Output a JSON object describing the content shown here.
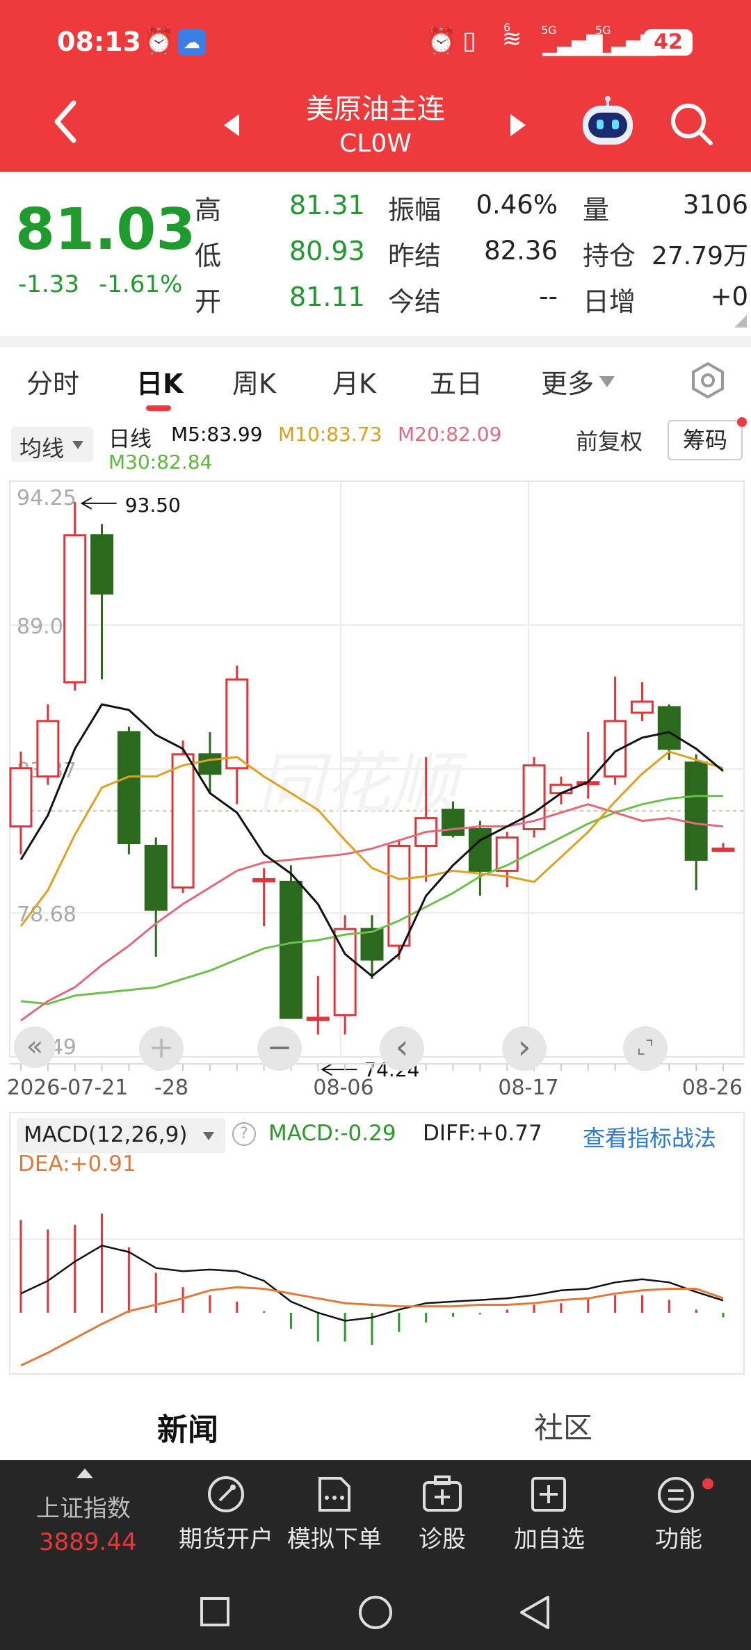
{
  "status_bar": {
    "time": "08:13",
    "signal1": "5G",
    "signal2": "5G",
    "battery": "42",
    "wifi_badge": "6"
  },
  "header": {
    "title": "美原油主连",
    "code": "CL0W"
  },
  "quote": {
    "price": "81.03",
    "change": "-1.33",
    "change_pct": "-1.61%",
    "fields": [
      {
        "label": "高",
        "value": "81.31"
      },
      {
        "label": "低",
        "value": "80.93"
      },
      {
        "label": "开",
        "value": "81.11"
      },
      {
        "label": "振幅",
        "value": "0.46%"
      },
      {
        "label": "昨结",
        "value": "82.36"
      },
      {
        "label": "今结",
        "value": "--"
      },
      {
        "label": "量",
        "value": "3106"
      },
      {
        "label": "持仓",
        "value": "27.79万"
      },
      {
        "label": "日增",
        "value": "+0"
      }
    ]
  },
  "tabs": [
    "分时",
    "日K",
    "周K",
    "月K",
    "五日",
    "更多"
  ],
  "active_tab": "日K",
  "ma_bar": {
    "selector": "均线",
    "kind": "日线",
    "m5": "M5:83.99",
    "m10": "M10:83.73",
    "m20": "M20:82.09",
    "m30": "M30:82.84",
    "fq": "前复权",
    "chip": "筹码"
  },
  "colors": {
    "red": "#ee3a3c",
    "up": "#e3343b",
    "down": "#2b6a1c",
    "m5": "#111111",
    "m10": "#e0a020",
    "m20": "#e06a7a",
    "m30": "#6cc04a",
    "dea": "#e07a3a",
    "accent_blue": "#2a7bd6"
  },
  "chart_data": {
    "type": "candlestick",
    "y_ticks": [
      "94.25",
      "89.06",
      "83.87",
      "78.68",
      "73.49"
    ],
    "ylim": [
      73.49,
      94.25
    ],
    "x_ticks": [
      "2026-07-21",
      "-28",
      "08-06",
      "08-17",
      "08-26"
    ],
    "annotations": {
      "high": "93.50",
      "low": "74.24"
    },
    "candles": [
      {
        "o": 81.8,
        "h": 84.5,
        "l": 80.8,
        "c": 83.9
      },
      {
        "o": 83.6,
        "h": 86.2,
        "l": 83.3,
        "c": 85.6
      },
      {
        "o": 87.0,
        "h": 93.5,
        "l": 86.7,
        "c": 92.3
      },
      {
        "o": 92.3,
        "h": 92.7,
        "l": 87.1,
        "c": 90.2
      },
      {
        "o": 85.2,
        "h": 85.4,
        "l": 80.8,
        "c": 81.2
      },
      {
        "o": 81.1,
        "h": 81.4,
        "l": 77.1,
        "c": 78.8
      },
      {
        "o": 79.6,
        "h": 84.9,
        "l": 79.4,
        "c": 84.4
      },
      {
        "o": 84.4,
        "h": 85.2,
        "l": 83.0,
        "c": 83.7
      },
      {
        "o": 83.9,
        "h": 87.6,
        "l": 82.6,
        "c": 87.1
      },
      {
        "o": 79.9,
        "h": 80.3,
        "l": 78.2,
        "c": 79.9
      },
      {
        "o": 79.8,
        "h": 80.4,
        "l": 74.9,
        "c": 74.9
      },
      {
        "o": 74.9,
        "h": 76.4,
        "l": 74.3,
        "c": 74.9
      },
      {
        "o": 75.0,
        "h": 78.6,
        "l": 74.3,
        "c": 78.1
      },
      {
        "o": 78.1,
        "h": 78.6,
        "l": 76.3,
        "c": 77.0
      },
      {
        "o": 77.5,
        "h": 81.3,
        "l": 77.0,
        "c": 81.1
      },
      {
        "o": 81.1,
        "h": 84.3,
        "l": 79.8,
        "c": 82.1
      },
      {
        "o": 82.4,
        "h": 82.7,
        "l": 81.4,
        "c": 81.5
      },
      {
        "o": 81.7,
        "h": 82.0,
        "l": 79.3,
        "c": 80.2
      },
      {
        "o": 80.2,
        "h": 81.6,
        "l": 79.6,
        "c": 81.4
      },
      {
        "o": 81.7,
        "h": 84.3,
        "l": 81.4,
        "c": 84.0
      },
      {
        "o": 83.0,
        "h": 83.6,
        "l": 82.6,
        "c": 83.3
      },
      {
        "o": 83.4,
        "h": 85.2,
        "l": 82.8,
        "c": 83.4
      },
      {
        "o": 83.6,
        "h": 87.2,
        "l": 83.3,
        "c": 85.6
      },
      {
        "o": 85.9,
        "h": 87.0,
        "l": 85.6,
        "c": 86.3
      },
      {
        "o": 86.1,
        "h": 86.2,
        "l": 84.2,
        "c": 84.6
      },
      {
        "o": 84.1,
        "h": 84.4,
        "l": 79.5,
        "c": 80.6
      },
      {
        "o": 81.0,
        "h": 81.2,
        "l": 80.9,
        "c": 81.0
      }
    ],
    "m5": [
      80.6,
      82.2,
      84.6,
      86.2,
      86.0,
      85.1,
      84.6,
      83.0,
      82.3,
      80.8,
      80.1,
      79.0,
      77.2,
      76.4,
      77.2,
      79.3,
      80.4,
      81.3,
      81.8,
      82.3,
      83.0,
      83.4,
      84.5,
      85.0,
      85.2,
      84.6,
      83.8
    ],
    "m10": [
      78.2,
      79.5,
      81.5,
      83.2,
      83.6,
      83.6,
      84.0,
      84.2,
      84.3,
      83.6,
      83.0,
      82.4,
      81.3,
      80.3,
      79.9,
      80.0,
      80.2,
      80.1,
      80.0,
      79.8,
      80.7,
      81.6,
      82.7,
      83.7,
      84.5,
      84.2,
      83.9
    ],
    "m20": [
      74.8,
      75.5,
      76.0,
      76.8,
      77.5,
      78.3,
      79.0,
      79.6,
      80.2,
      80.5,
      80.6,
      80.7,
      80.8,
      81.0,
      81.3,
      81.6,
      81.7,
      81.8,
      81.8,
      82.0,
      82.3,
      82.6,
      82.3,
      82.0,
      82.1,
      81.9,
      81.8
    ],
    "m30": [
      75.5,
      75.4,
      75.7,
      75.8,
      75.9,
      76.0,
      76.3,
      76.6,
      77.0,
      77.4,
      77.6,
      77.7,
      77.9,
      78.0,
      78.4,
      78.9,
      79.4,
      80.0,
      80.4,
      80.9,
      81.4,
      81.9,
      82.3,
      82.6,
      82.8,
      82.9,
      82.9
    ],
    "macd": {
      "label": "MACD(12,26,9)",
      "macd_text": "MACD:-0.29",
      "diff_text": "DIFF:+0.77",
      "dea_text": "DEA:+0.91",
      "link": "查看指标战法",
      "hist": [
        5.8,
        5.2,
        5.5,
        6.2,
        4.1,
        2.5,
        1.6,
        1.1,
        0.7,
        0.1,
        -1.0,
        -1.8,
        -1.8,
        -2.0,
        -1.2,
        -0.6,
        -0.25,
        -0.1,
        0.2,
        0.5,
        0.6,
        0.9,
        1.1,
        1.1,
        0.8,
        0.2,
        -0.29
      ],
      "diff": [
        1.2,
        2.0,
        3.2,
        4.2,
        3.8,
        2.8,
        2.6,
        2.7,
        2.6,
        2.0,
        0.7,
        0.0,
        -0.5,
        -0.3,
        0.2,
        0.6,
        0.7,
        0.8,
        0.9,
        1.1,
        1.4,
        1.5,
        1.9,
        2.1,
        1.9,
        1.3,
        0.77
      ],
      "dea": [
        -3.3,
        -2.5,
        -1.6,
        -0.7,
        0.1,
        0.5,
        0.9,
        1.4,
        1.6,
        1.5,
        1.2,
        0.9,
        0.6,
        0.5,
        0.4,
        0.4,
        0.4,
        0.5,
        0.5,
        0.6,
        0.8,
        0.9,
        1.2,
        1.4,
        1.5,
        1.5,
        0.91
      ]
    }
  },
  "chart_controls": [
    "«",
    "+",
    "−",
    "‹",
    "›",
    "⌞⌝"
  ],
  "sections": {
    "news": "新闻",
    "community": "社区"
  },
  "bottom_nav": {
    "index_name": "上证指数",
    "index_value": "3889.44",
    "items": [
      "期货开户",
      "模拟下单",
      "诊股",
      "加自选",
      "功能"
    ]
  },
  "watermark": "同花顺"
}
